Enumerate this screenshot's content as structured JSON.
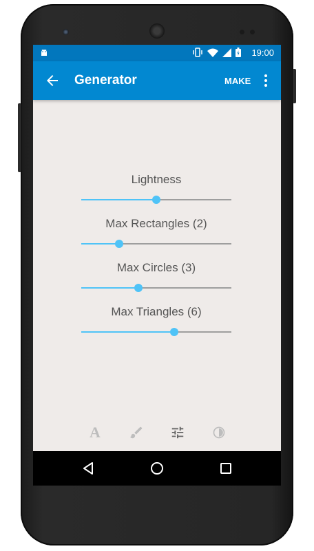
{
  "status_bar": {
    "time": "19:00"
  },
  "toolbar": {
    "title": "Generator",
    "make_label": "MAKE"
  },
  "sliders": [
    {
      "label": "Lightness",
      "value": 0.5
    },
    {
      "label": "Max Rectangles (2)",
      "value": 0.25
    },
    {
      "label": "Max Circles (3)",
      "value": 0.38
    },
    {
      "label": "Max Triangles (6)",
      "value": 0.62
    }
  ],
  "colors": {
    "status_bar": "#0277bd",
    "toolbar": "#0288d1",
    "accent": "#4fc3f7",
    "background": "#efebe9"
  },
  "bottom_tabs": [
    {
      "icon": "text-icon",
      "label": "A"
    },
    {
      "icon": "brush-icon"
    },
    {
      "icon": "tune-icon",
      "selected": true
    },
    {
      "icon": "contrast-icon"
    }
  ],
  "navigation_bar": {
    "icons": [
      "back-icon",
      "home-icon",
      "recents-icon"
    ]
  }
}
